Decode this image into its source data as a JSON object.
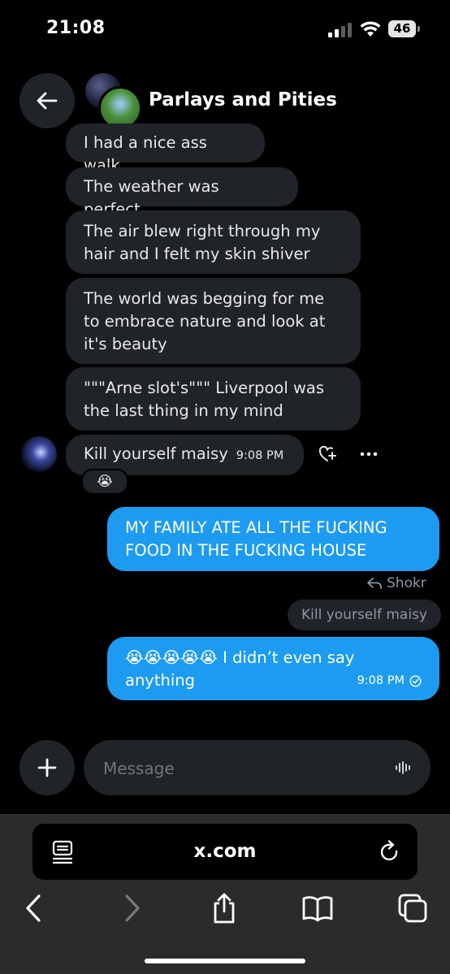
{
  "status_bar": {
    "time": "21:08",
    "battery": "46"
  },
  "header": {
    "title": "Parlays and Pities"
  },
  "incoming_messages": [
    "I had a nice ass walk",
    "The weather was perfect",
    "The air blew right through my hair and I felt my skin shiver",
    "The world was begging for me to embrace nature and look at it's beauty",
    "\"\"\"Arne slot's\"\"\" Liverpool was the last thing in my mind"
  ],
  "last_incoming": {
    "text": "Kill yourself maisy",
    "time": "9:08 PM",
    "reaction": "😭"
  },
  "outgoing_1": {
    "text": "MY FAMILY ATE ALL THE FUCKING FOOD IN THE FUCKING HOUSE"
  },
  "reply": {
    "label": "Shokr",
    "quoted": "Kill yourself maisy"
  },
  "outgoing_2": {
    "text": "😭😭😭😭😭 I didn’t even say anything",
    "time": "9:08 PM"
  },
  "composer": {
    "placeholder": "Message"
  },
  "browser": {
    "url": "x.com"
  },
  "colors": {
    "accent": "#1d9bf0",
    "bubble_in": "#202327",
    "background": "#000000"
  }
}
